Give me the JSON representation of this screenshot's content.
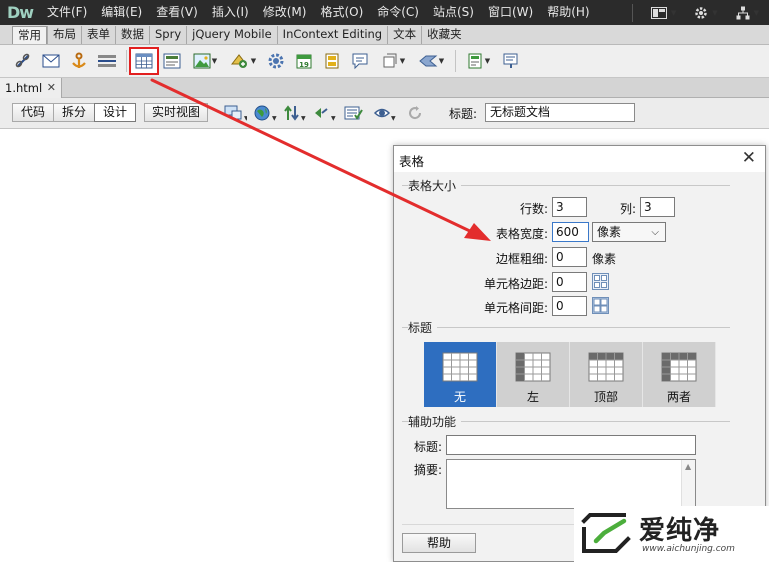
{
  "app": {
    "logo": "Dw"
  },
  "menu": {
    "items": [
      "文件(F)",
      "编辑(E)",
      "查看(V)",
      "插入(I)",
      "修改(M)",
      "格式(O)",
      "命令(C)",
      "站点(S)",
      "窗口(W)",
      "帮助(H)"
    ]
  },
  "insert_tabs": [
    "常用",
    "布局",
    "表单",
    "数据",
    "Spry",
    "jQuery Mobile",
    "InContext Editing",
    "文本",
    "收藏夹"
  ],
  "document": {
    "tab": "1.html",
    "views": [
      "代码",
      "拆分",
      "设计"
    ],
    "live_view": "实时视图",
    "title_label": "标题:",
    "title_value": "无标题文档"
  },
  "dialog": {
    "title": "表格",
    "size_section": "表格大小",
    "rows_label": "行数:",
    "rows_value": "3",
    "cols_label": "列:",
    "cols_value": "3",
    "width_label": "表格宽度:",
    "width_value": "600",
    "width_unit": "像素",
    "border_label": "边框粗细:",
    "border_value": "0",
    "border_unit": "像素",
    "padding_label": "单元格边距:",
    "padding_value": "0",
    "spacing_label": "单元格间距:",
    "spacing_value": "0",
    "header_section": "标题",
    "header_options": [
      "无",
      "左",
      "顶部",
      "两者"
    ],
    "access_section": "辅助功能",
    "caption_label": "标题:",
    "caption_value": "",
    "summary_label": "摘要:",
    "help_button": "帮助"
  },
  "watermark": {
    "text": "爱纯净",
    "url": "www.aichunjing.com"
  },
  "colors": {
    "menubar": "#2b2b2b",
    "highlight": "#e21f1f",
    "selected": "#2e6ec0"
  }
}
